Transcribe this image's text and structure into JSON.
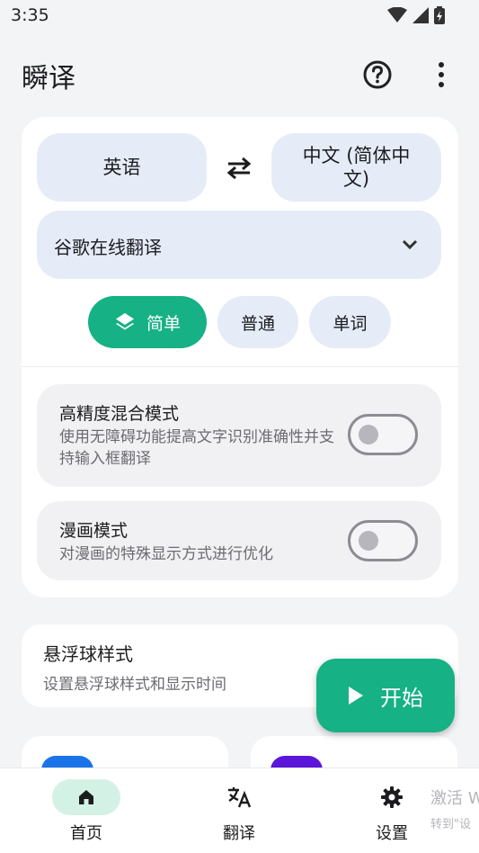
{
  "status": {
    "time": "3:35"
  },
  "header": {
    "title": "瞬译"
  },
  "languages": {
    "source": "英语",
    "target": "中文 (简体中文)"
  },
  "engine": {
    "label": "谷歌在线翻译"
  },
  "modes": [
    {
      "label": "简单",
      "selected": true
    },
    {
      "label": "普通",
      "selected": false
    },
    {
      "label": "单词",
      "selected": false
    }
  ],
  "settings": {
    "high_precision": {
      "title": "高精度混合模式",
      "desc": "使用无障碍功能提高文字识别准确性并支持输入框翻译",
      "enabled": false
    },
    "manga": {
      "title": "漫画模式",
      "desc": "对漫画的特殊显示方式进行优化",
      "enabled": false
    }
  },
  "floating_ball": {
    "title": "悬浮球样式",
    "desc": "设置悬浮球样式和显示时间"
  },
  "fab": {
    "label": "开始"
  },
  "nav": {
    "home": "首页",
    "translate": "翻译",
    "settings": "设置"
  },
  "watermark": {
    "line1": "激活 W",
    "line2": "转到\"设"
  },
  "colors": {
    "accent": "#16b185",
    "chip_bg": "#e5ecf7",
    "peek_blue": "#1a73e8",
    "peek_purple": "#5b16d9"
  },
  "icons": [
    "help-icon",
    "more-vert-icon",
    "swap-icon",
    "chevron-down-icon",
    "layers-icon",
    "play-icon",
    "home-icon",
    "translate-icon",
    "gear-icon"
  ]
}
